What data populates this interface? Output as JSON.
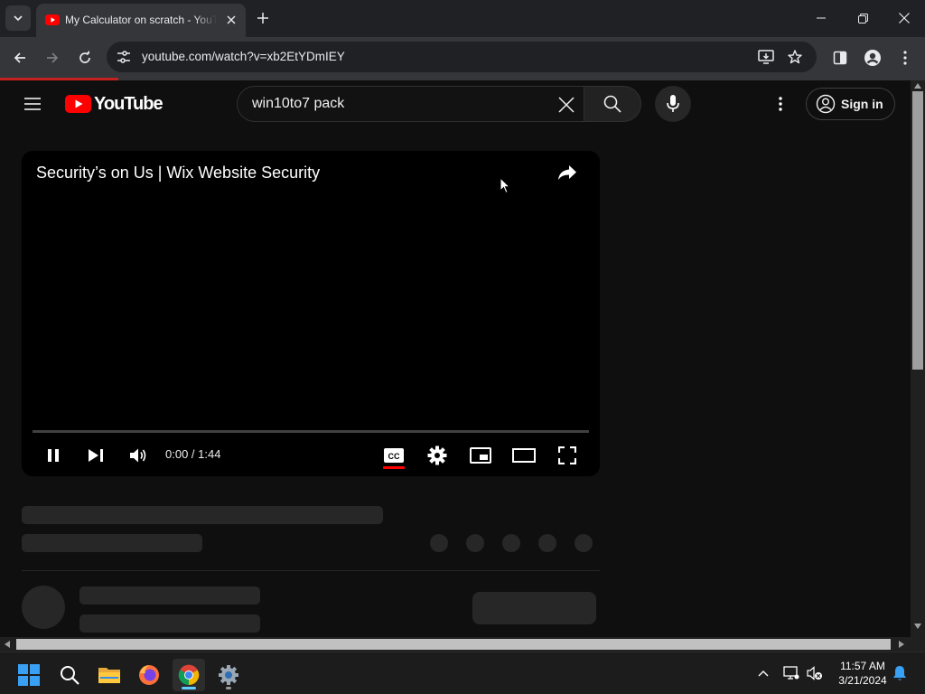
{
  "browser": {
    "tab_title": "My Calculator on scratch - YouTube",
    "url": "youtube.com/watch?v=xb2EtYDmIEY"
  },
  "youtube": {
    "logo_text": "YouTube",
    "search_query": "win10to7 pack",
    "signin_label": "Sign in",
    "video": {
      "title": "Security’s on Us | Wix Website Security",
      "time": "0:00 / 1:44",
      "progress_fraction": 0
    }
  },
  "taskbar": {
    "time": "11:57 AM",
    "date": "3/21/2024"
  },
  "colors": {
    "youtube_red": "#ff0000",
    "loading_bar": "#c5221f",
    "page_bg": "#0f0f0f",
    "skeleton": "#272727"
  },
  "icons": [
    "tab-search-icon",
    "youtube-favicon",
    "close-icon",
    "plus-icon",
    "minimize-icon",
    "restore-icon",
    "back-icon",
    "forward-icon",
    "reload-icon",
    "site-info-icon",
    "install-app-icon",
    "bookmark-star-icon",
    "side-panel-icon",
    "profile-icon",
    "chrome-menu-icon",
    "hamburger-icon",
    "youtube-logo-icon",
    "clear-icon",
    "search-icon",
    "microphone-icon",
    "more-vert-icon",
    "account-icon",
    "share-icon",
    "pause-icon",
    "next-icon",
    "volume-icon",
    "captions-icon",
    "settings-icon",
    "miniplayer-icon",
    "theater-icon",
    "fullscreen-icon",
    "windows-start-icon",
    "taskbar-search-icon",
    "file-explorer-icon",
    "firefox-icon",
    "chrome-icon",
    "settings-app-icon",
    "tray-chevron-icon",
    "network-icon",
    "volume-muted-icon",
    "notification-bell-icon"
  ]
}
